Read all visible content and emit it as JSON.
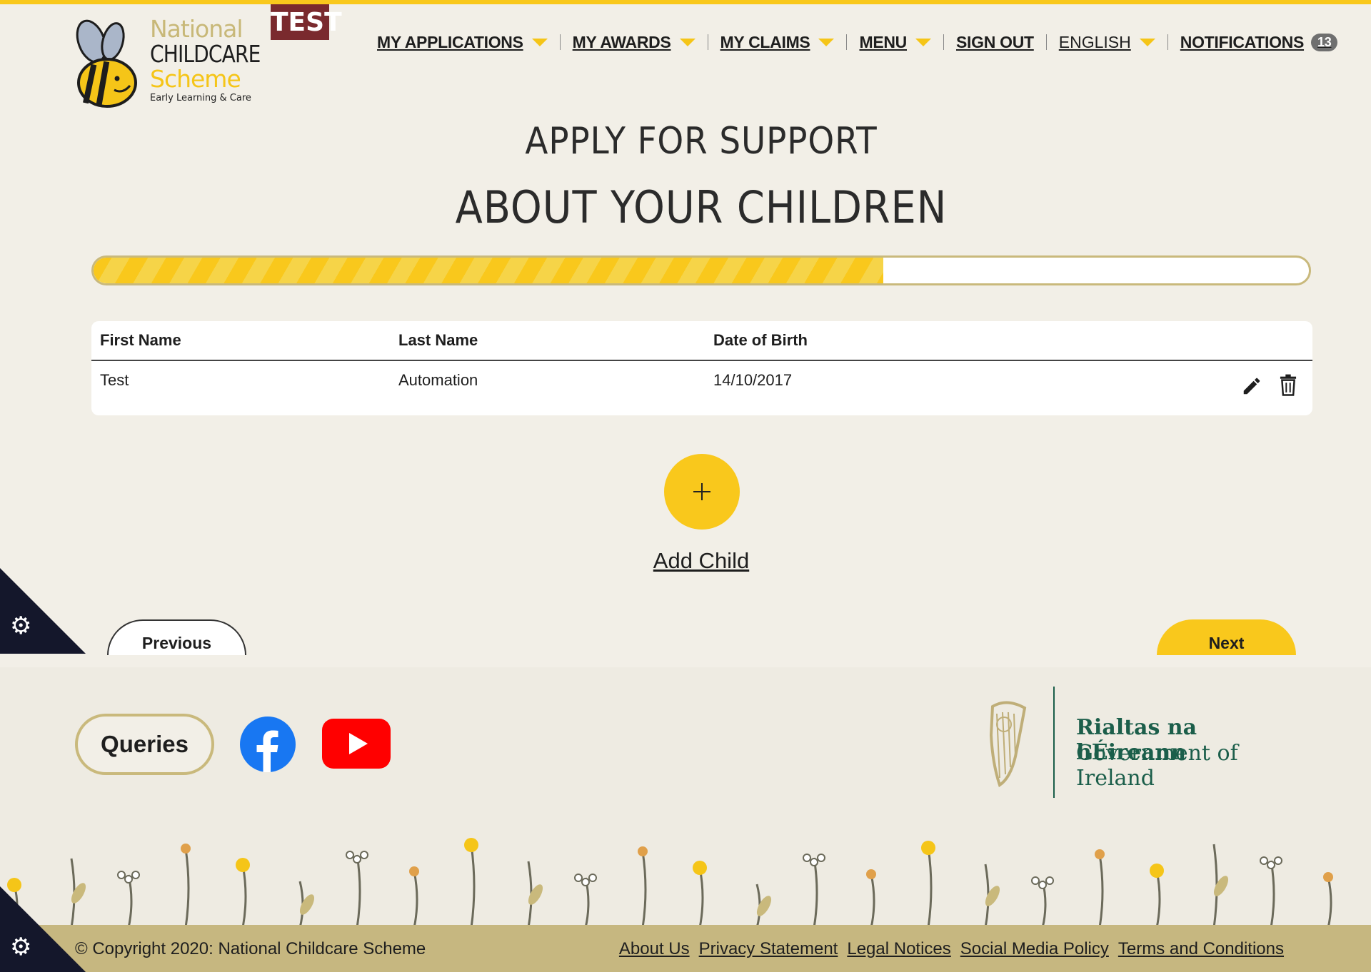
{
  "header": {
    "logo": {
      "line1": "National",
      "line2": "CHILDCARE",
      "line3": "Scheme",
      "line4": "Early Learning & Care"
    },
    "env_badge": "TEST",
    "nav": {
      "my_applications": "MY APPLICATIONS",
      "my_awards": "MY AWARDS",
      "my_claims": "MY CLAIMS",
      "menu": "MENU",
      "sign_out": "SIGN OUT",
      "language": "ENGLISH",
      "notifications": "NOTIFICATIONS",
      "notifications_count": "13"
    }
  },
  "page": {
    "title": "APPLY FOR SUPPORT",
    "subtitle": "ABOUT YOUR CHILDREN",
    "progress_fraction": 0.65
  },
  "children_table": {
    "columns": [
      "First Name",
      "Last Name",
      "Date of Birth"
    ],
    "rows": [
      {
        "first_name": "Test",
        "last_name": "Automation",
        "dob": "14/10/2017"
      }
    ]
  },
  "actions": {
    "add_child_label": "Add Child",
    "add_child_icon": "plus-icon",
    "previous_label": "Previous",
    "next_label": "Next",
    "edit_icon": "pencil-icon",
    "delete_icon": "trash-icon"
  },
  "footer": {
    "queries_label": "Queries",
    "gov_line1": "Rialtas na hÉireann",
    "gov_line2": "Government of Ireland",
    "copyright": "© Copyright 2020: National Childcare Scheme",
    "links": [
      "About Us",
      "Privacy Statement",
      "Legal Notices",
      "Social Media Policy",
      "Terms and Conditions"
    ]
  },
  "colors": {
    "accent_yellow": "#f9c81c",
    "background": "#f2efe7",
    "footer_bar": "#c6b780",
    "test_badge": "#7a2a2e",
    "gov_green": "#1b5e4a"
  }
}
